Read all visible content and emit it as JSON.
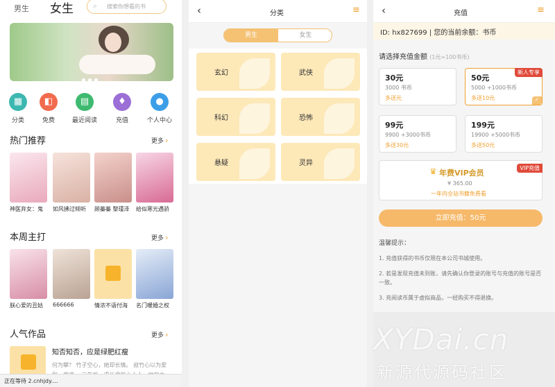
{
  "p1": {
    "tab_boy": "男生",
    "tab_girl": "女生",
    "search_placeholder": "搜索你想看的书",
    "nav": [
      {
        "label": "分类",
        "icon": "grid-icon",
        "color": "#3db8b0"
      },
      {
        "label": "免费",
        "icon": "free-icon",
        "color": "#f26b4e"
      },
      {
        "label": "最近阅读",
        "icon": "book-icon",
        "color": "#3dba6f"
      },
      {
        "label": "充值",
        "icon": "wallet-icon",
        "color": "#9b6fd6"
      },
      {
        "label": "个人中心",
        "icon": "user-icon",
        "color": "#3d9ee8"
      }
    ],
    "hot": {
      "title": "热门推荐",
      "more": "更多",
      "books": [
        "神医弃女：鬼",
        "如风拂过倾听",
        "顾蓁蓁 黎瑾泽",
        "给似寒光遇骄"
      ]
    },
    "weekly": {
      "title": "本周主打",
      "more": "更多",
      "books": [
        "朕心爱的丑姑",
        "666666",
        "情浓不语付海",
        "名门暖婚之权"
      ]
    },
    "popular": {
      "title": "人气作品",
      "more": "更多",
      "item_title": "知否知否，应是绿肥红瘦",
      "item_desc": "何为攀？ 竹子空心，她却长情。 叔竹心以为爱到。悲凉。 三年后，虐长君的心上人，她的大..."
    },
    "status": "正在等待 2.cnhjdy...."
  },
  "p2": {
    "title": "分类",
    "seg_a": "男生",
    "seg_b": "女生",
    "cats": [
      "玄幻",
      "武侠",
      "科幻",
      "恐怖",
      "悬疑",
      "灵异"
    ]
  },
  "p3": {
    "title": "充值",
    "id_line": "ID:  hx827699  |  您的当前余额：书币",
    "select": "请选择充值金额",
    "rate": "(1元=100书币)",
    "packages": [
      {
        "price": "30元",
        "coins": "3000 书币",
        "bonus": "多送元",
        "tag": ""
      },
      {
        "price": "50元",
        "coins": "5000 +1000书币",
        "bonus": "多送10元",
        "tag": "新人专享"
      },
      {
        "price": "99元",
        "coins": "9900 +3000书币",
        "bonus": "多送30元",
        "tag": ""
      },
      {
        "price": "199元",
        "coins": "19900 +5000书币",
        "bonus": "多送50元",
        "tag": ""
      }
    ],
    "vip_title": "年费VIP会员",
    "vip_price": "¥ 365.00",
    "vip_desc": "一年内全站书籍免费看",
    "vip_tag": "VIP充值",
    "pay_button": "立即充值：50元",
    "tips_title": "温馨提示：",
    "tips": [
      "1. 充值获得的书币仅限在本公司书城使用。",
      "2. 若是发现充值未到账，请先确认你登录的账号与充值的账号是否一致。",
      "3. 充阅读币属于虚拟商品，一经购买不得退换。"
    ]
  },
  "watermark": {
    "line1": "XYDai.cn",
    "line2": "新源代源码社区"
  }
}
